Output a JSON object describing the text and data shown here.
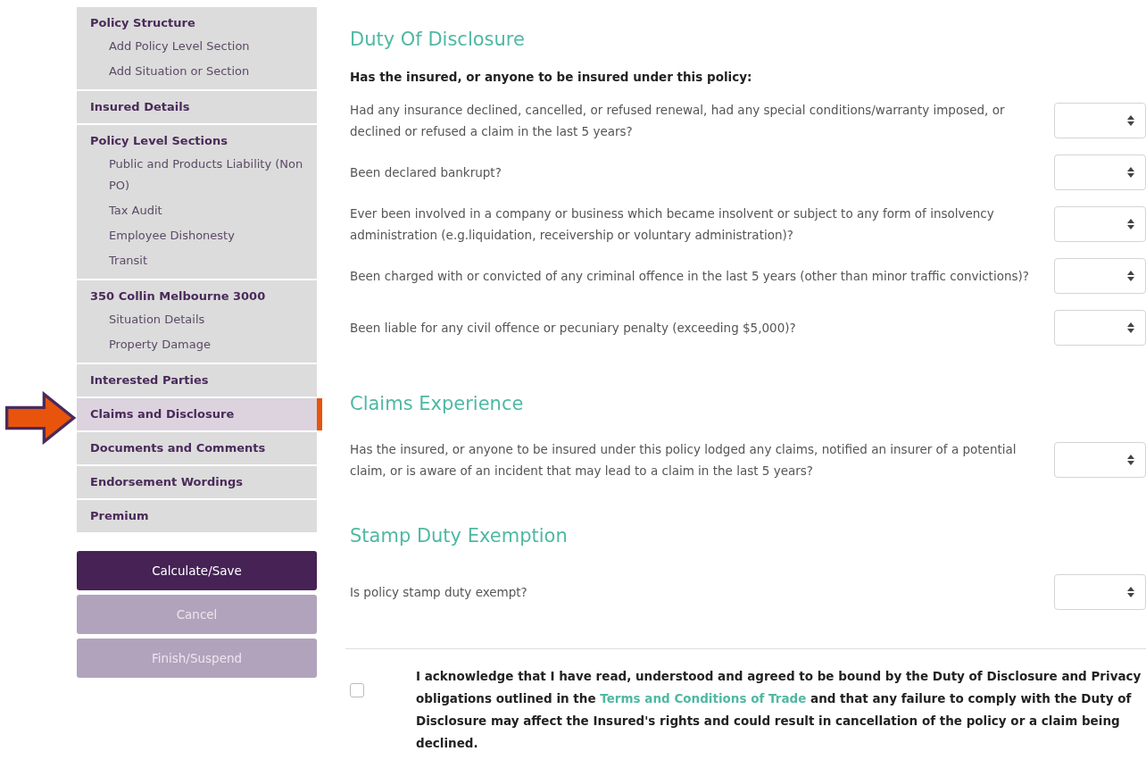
{
  "sidebar": {
    "groups": [
      {
        "heading": "Policy Structure",
        "selected": false,
        "items": [
          "Add Policy Level Section",
          "Add Situation or Section"
        ]
      },
      {
        "heading": "Insured Details",
        "selected": false
      },
      {
        "heading": "Policy Level Sections",
        "selected": false,
        "items": [
          "Public and Products Liability (Non PO)",
          "Tax Audit",
          "Employee Dishonesty",
          "Transit"
        ]
      },
      {
        "heading": "350 Collin Melbourne 3000",
        "selected": false,
        "items": [
          "Situation Details",
          "Property Damage"
        ]
      },
      {
        "heading": "Interested Parties",
        "selected": false
      },
      {
        "heading": "Claims and Disclosure",
        "selected": true
      },
      {
        "heading": "Documents and Comments",
        "selected": false
      },
      {
        "heading": "Endorsement Wordings",
        "selected": false
      },
      {
        "heading": "Premium",
        "selected": false
      }
    ],
    "buttons": [
      {
        "label": "Calculate/Save",
        "disabled": false
      },
      {
        "label": "Cancel",
        "disabled": true
      },
      {
        "label": "Finish/Suspend",
        "disabled": true
      }
    ]
  },
  "sections": [
    {
      "title": "Duty Of Disclosure",
      "intro": "Has the insured, or anyone to be insured under this policy:",
      "questions": [
        "Had any insurance declined, cancelled, or refused renewal, had any special conditions/warranty imposed, or declined or refused a claim in the last 5 years?",
        "Been declared bankrupt?",
        "Ever been involved in a company or business which became insolvent or subject to any form of insolvency administration (e.g.liquidation, receivership or voluntary administration)?",
        "Been charged with or convicted of any criminal offence in the last 5 years (other than minor traffic convictions)?",
        "Been liable for any civil offence or pecuniary penalty (exceeding $5,000)?"
      ]
    },
    {
      "title": "Claims Experience",
      "questions": [
        "Has the insured, or anyone to be insured under this policy lodged any claims, notified an insurer of a potential claim, or is aware of an incident that may lead to a claim in the last 5 years?"
      ]
    },
    {
      "title": "Stamp Duty Exemption",
      "questions": [
        "Is policy stamp duty exempt?"
      ]
    }
  ],
  "acknowledgement": {
    "checked": false,
    "text_before": "I acknowledge that I have read, understood and agreed to be bound by the Duty of Disclosure and Privacy obligations outlined in the",
    "link": "Terms and Conditions of Trade",
    "text_after": "and that any failure to comply with the Duty of Disclosure may affect the Insured's rights and could result in cancellation of the policy or a claim being declined."
  }
}
